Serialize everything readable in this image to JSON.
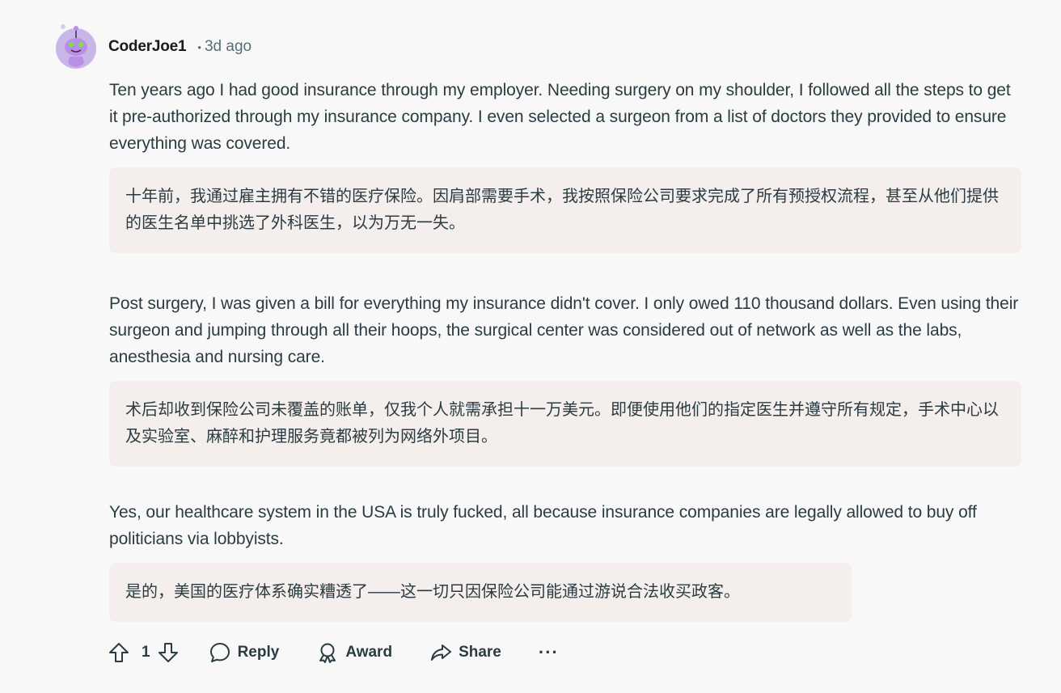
{
  "comment": {
    "author": "CoderJoe1",
    "separator": "•",
    "time_ago": "3d ago",
    "paragraphs": [
      {
        "text": "Ten years ago I had good insurance through my employer. Needing surgery on my shoulder, I followed all the steps to get it pre-authorized through my insurance company. I even selected a surgeon from a list of doctors they provided to ensure everything was covered.",
        "translation": "十年前，我通过雇主拥有不错的医疗保险。因肩部需要手术，我按照保险公司要求完成了所有预授权流程，甚至从他们提供的医生名单中挑选了外科医生，以为万无一失。"
      },
      {
        "text": "Post surgery, I was given a bill for everything my insurance didn't cover. I only owed 110 thousand dollars. Even using their surgeon and jumping through all their hoops, the surgical center was considered out of network as well as the labs, anesthesia and nursing care.",
        "translation": "术后却收到保险公司未覆盖的账单，仅我个人就需承担十一万美元。即便使用他们的指定医生并遵守所有规定，手术中心以及实验室、麻醉和护理服务竟都被列为网络外项目。"
      },
      {
        "text": "Yes, our healthcare system in the USA is truly fucked, all because insurance companies are legally allowed to buy off politicians via lobbyists.",
        "translation": "是的，美国的医疗体系确实糟透了——这一切只因保险公司能通过游说合法收买政客。"
      }
    ]
  },
  "actions": {
    "vote_count": "1",
    "reply_label": "Reply",
    "award_label": "Award",
    "share_label": "Share",
    "more_label": "···"
  },
  "colors": {
    "background": "#f9f8f8",
    "translation_bg": "#f4eeed",
    "text": "#2a3c42",
    "meta": "#576f76",
    "avatar_purple": "#b98ee6"
  },
  "icons": {
    "avatar": "snoo-avatar",
    "upvote": "arrow-up-outline-icon",
    "downvote": "arrow-down-outline-icon",
    "reply": "speech-bubble-icon",
    "award": "award-medal-icon",
    "share": "share-arrow-icon"
  }
}
